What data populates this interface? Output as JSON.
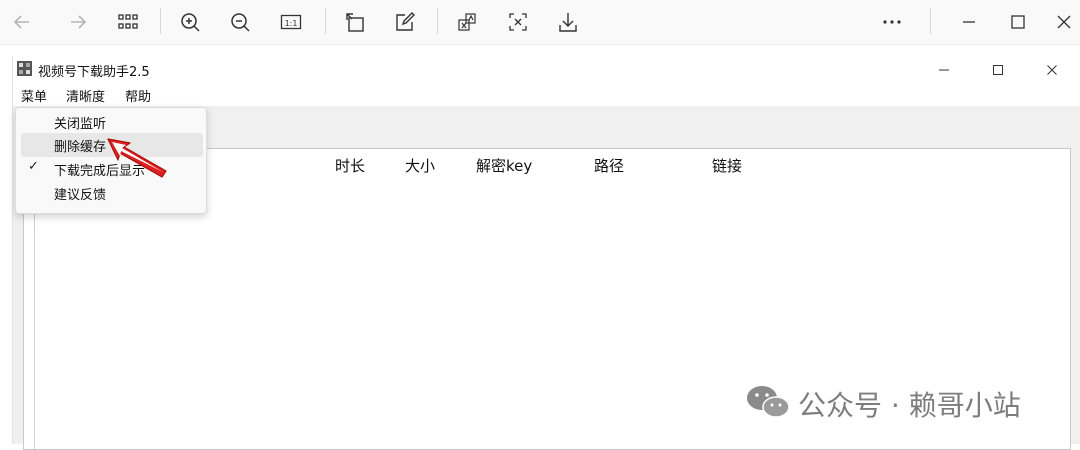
{
  "viewer_toolbar": {
    "buttons": [
      {
        "icon": "arrow-left-icon"
      },
      {
        "icon": "arrow-right-icon"
      },
      {
        "icon": "grid-icon"
      },
      {
        "icon": "zoom-in-icon"
      },
      {
        "icon": "zoom-out-icon"
      },
      {
        "icon": "actual-size-icon",
        "label": "1:1"
      },
      {
        "icon": "rotate-icon"
      },
      {
        "icon": "edit-icon"
      },
      {
        "icon": "translate-icon"
      },
      {
        "icon": "text-recognition-icon"
      },
      {
        "icon": "download-icon"
      },
      {
        "icon": "more-icon"
      },
      {
        "icon": "minimize-icon"
      },
      {
        "icon": "maximize-icon"
      },
      {
        "icon": "close-icon"
      }
    ]
  },
  "app": {
    "title": "视频号下载助手2.5",
    "menu": [
      "菜单",
      "清晰度",
      "帮助"
    ],
    "columns": [
      "时长",
      "大小",
      "解密key",
      "路径",
      "链接"
    ],
    "dropdown": {
      "items": [
        {
          "label": "关闭监听",
          "checked": false,
          "highlighted": false
        },
        {
          "label": "删除缓存",
          "checked": false,
          "highlighted": true
        },
        {
          "label": "下载完成后显示",
          "checked": true,
          "highlighted": false
        },
        {
          "label": "建议反馈",
          "checked": false,
          "highlighted": false
        }
      ],
      "check_glyph": "✓"
    }
  },
  "watermark": {
    "text": "公众号 · 赖哥小站"
  },
  "colors": {
    "arrow": "#e02020",
    "accent_bg": "#f0f0f0"
  }
}
